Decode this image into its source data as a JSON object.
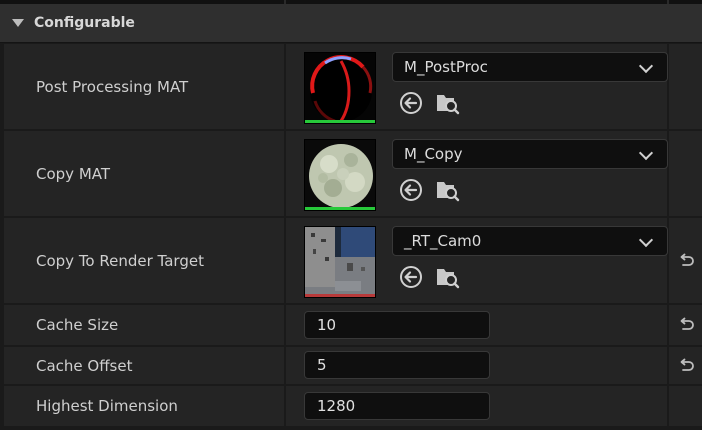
{
  "section": {
    "title": "Configurable",
    "collapse_icon": "triangle-down-icon"
  },
  "rows": [
    {
      "label": "Post Processing MAT",
      "asset": "M_PostProc",
      "thumbnail": "red-sphere-material-thumbnail",
      "status_color": "#27c93a",
      "has_reset": false
    },
    {
      "label": "Copy MAT",
      "asset": "M_Copy",
      "thumbnail": "stone-sphere-material-thumbnail",
      "status_color": "#27c93a",
      "has_reset": false
    },
    {
      "label": "Copy To Render Target",
      "asset": "_RT_Cam0",
      "thumbnail": "render-target-thumbnail",
      "status_color": "#b83a3a",
      "has_reset": true
    }
  ],
  "fields": [
    {
      "label": "Cache Size",
      "value": "10",
      "has_reset": true
    },
    {
      "label": "Cache Offset",
      "value": "5",
      "has_reset": true
    },
    {
      "label": "Highest Dimension",
      "value": "1280",
      "has_reset": false
    }
  ],
  "icons": {
    "use_selected": "arrow-left-circle-icon",
    "browse": "folder-search-icon",
    "reset": "reset-arrow-icon",
    "dropdown": "chevron-down-icon"
  },
  "colors": {
    "background": "#1a1a1a",
    "row": "#242424",
    "header": "#2f2f2f",
    "input": "#0f0f0f",
    "text": "#cfcfcf"
  }
}
